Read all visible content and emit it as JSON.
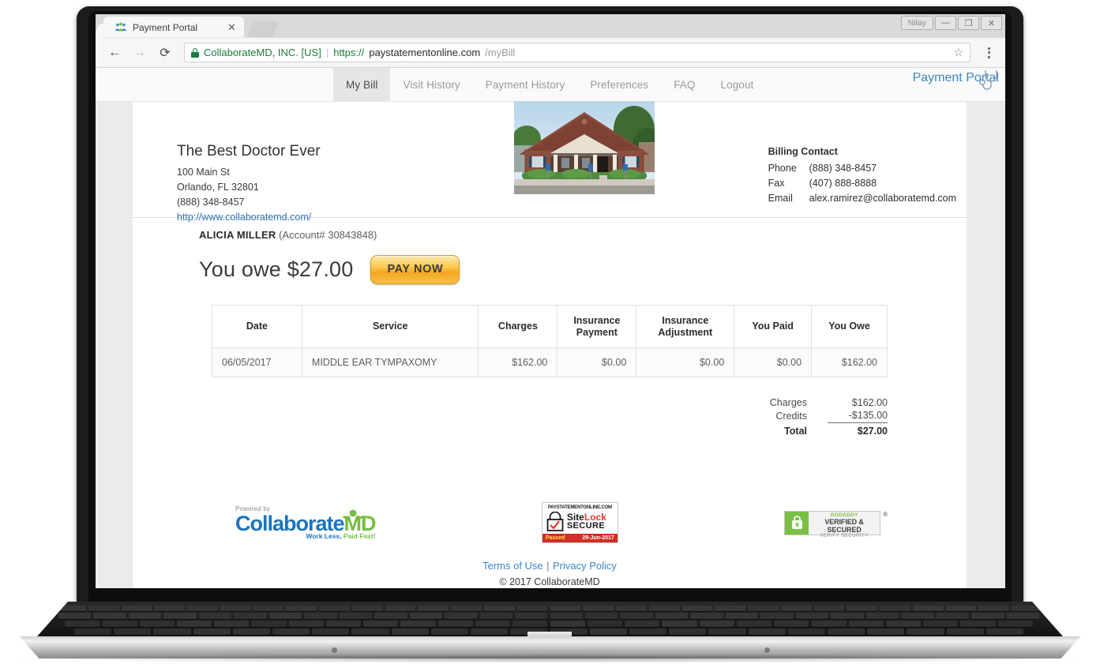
{
  "browser": {
    "tab_title": "Payment Portal",
    "tab_close_glyph": "✕",
    "back_glyph": "←",
    "forward_glyph": "→",
    "reload_glyph": "⟳",
    "site_identity": "CollaborateMD, INC. [US]",
    "omni_separator": "|",
    "url_scheme": "https://",
    "url_host": "paystatementonline.com",
    "url_path": "/myBill",
    "star_glyph": "☆",
    "user_chip": "Nilay",
    "minimize_glyph": "—",
    "restore_glyph": "❐",
    "close_glyph": "✕"
  },
  "sitenav": {
    "items": [
      {
        "label": "My Bill",
        "active": true
      },
      {
        "label": "Visit History",
        "active": false
      },
      {
        "label": "Payment History",
        "active": false
      },
      {
        "label": "Preferences",
        "active": false
      },
      {
        "label": "FAQ",
        "active": false
      },
      {
        "label": "Logout",
        "active": false
      }
    ],
    "brand": "Payment Portal",
    "brand_color": "#3d87c9"
  },
  "practice": {
    "name": "The Best Doctor Ever",
    "address_line1": "100 Main St",
    "address_line2": "Orlando, FL 32801",
    "phone": "(888) 348-8457",
    "website": "http://www.collaboratemd.com/",
    "photo_alt": "practice-building-photo"
  },
  "billing_contact": {
    "title": "Billing Contact",
    "phone_label": "Phone",
    "phone_value": "(888) 348-8457",
    "fax_label": "Fax",
    "fax_value": "(407) 888-8888",
    "email_label": "Email",
    "email_value": "alex.ramirez@collaboratemd.com"
  },
  "patient": {
    "name": "ALICIA MILLER",
    "account": "(Account# 30843848)"
  },
  "balance": {
    "owe_text": "You owe $27.00",
    "pay_button": "PAY NOW"
  },
  "table": {
    "headers": [
      "Date",
      "Service",
      "Charges",
      "Insurance Payment",
      "Insurance Adjustment",
      "You Paid",
      "You Owe"
    ],
    "headers_split": [
      [
        "Date"
      ],
      [
        "Service"
      ],
      [
        "Charges"
      ],
      [
        "Insurance",
        "Payment"
      ],
      [
        "Insurance",
        "Adjustment"
      ],
      [
        "You Paid"
      ],
      [
        "You Owe"
      ]
    ],
    "rows": [
      {
        "date": "06/05/2017",
        "service": "MIDDLE EAR TYMPAXOMY",
        "charges": "$162.00",
        "insurance_payment": "$0.00",
        "insurance_adjustment": "$0.00",
        "you_paid": "$0.00",
        "you_owe": "$162.00"
      }
    ]
  },
  "totals": {
    "charges_label": "Charges",
    "charges_value": "$162.00",
    "credits_label": "Credits",
    "credits_value": "-$135.00",
    "total_label": "Total",
    "total_value": "$27.00"
  },
  "footer": {
    "powered_by": "Powered by",
    "logo_word_1": "Collaborate",
    "logo_word_2": "MD",
    "logo_tagline_1": "Work Less,",
    "logo_tagline_2": "Paid Fast!",
    "sitelock_domain": "PAYSTATEMENTONLINE.COM",
    "sitelock_site": "Site",
    "sitelock_lock": "Lock",
    "sitelock_secure": "SECURE",
    "sitelock_passed": "Passed",
    "sitelock_date": "29-Jun-2017",
    "godaddy_brand": "GODADDY",
    "godaddy_verified": "VERIFIED & SECURED",
    "godaddy_sub": "VERIFY SECURITY",
    "godaddy_reg": "®",
    "terms": "Terms of Use",
    "separator": "|",
    "privacy": "Privacy Policy",
    "copyright": "© 2017 CollaborateMD"
  }
}
